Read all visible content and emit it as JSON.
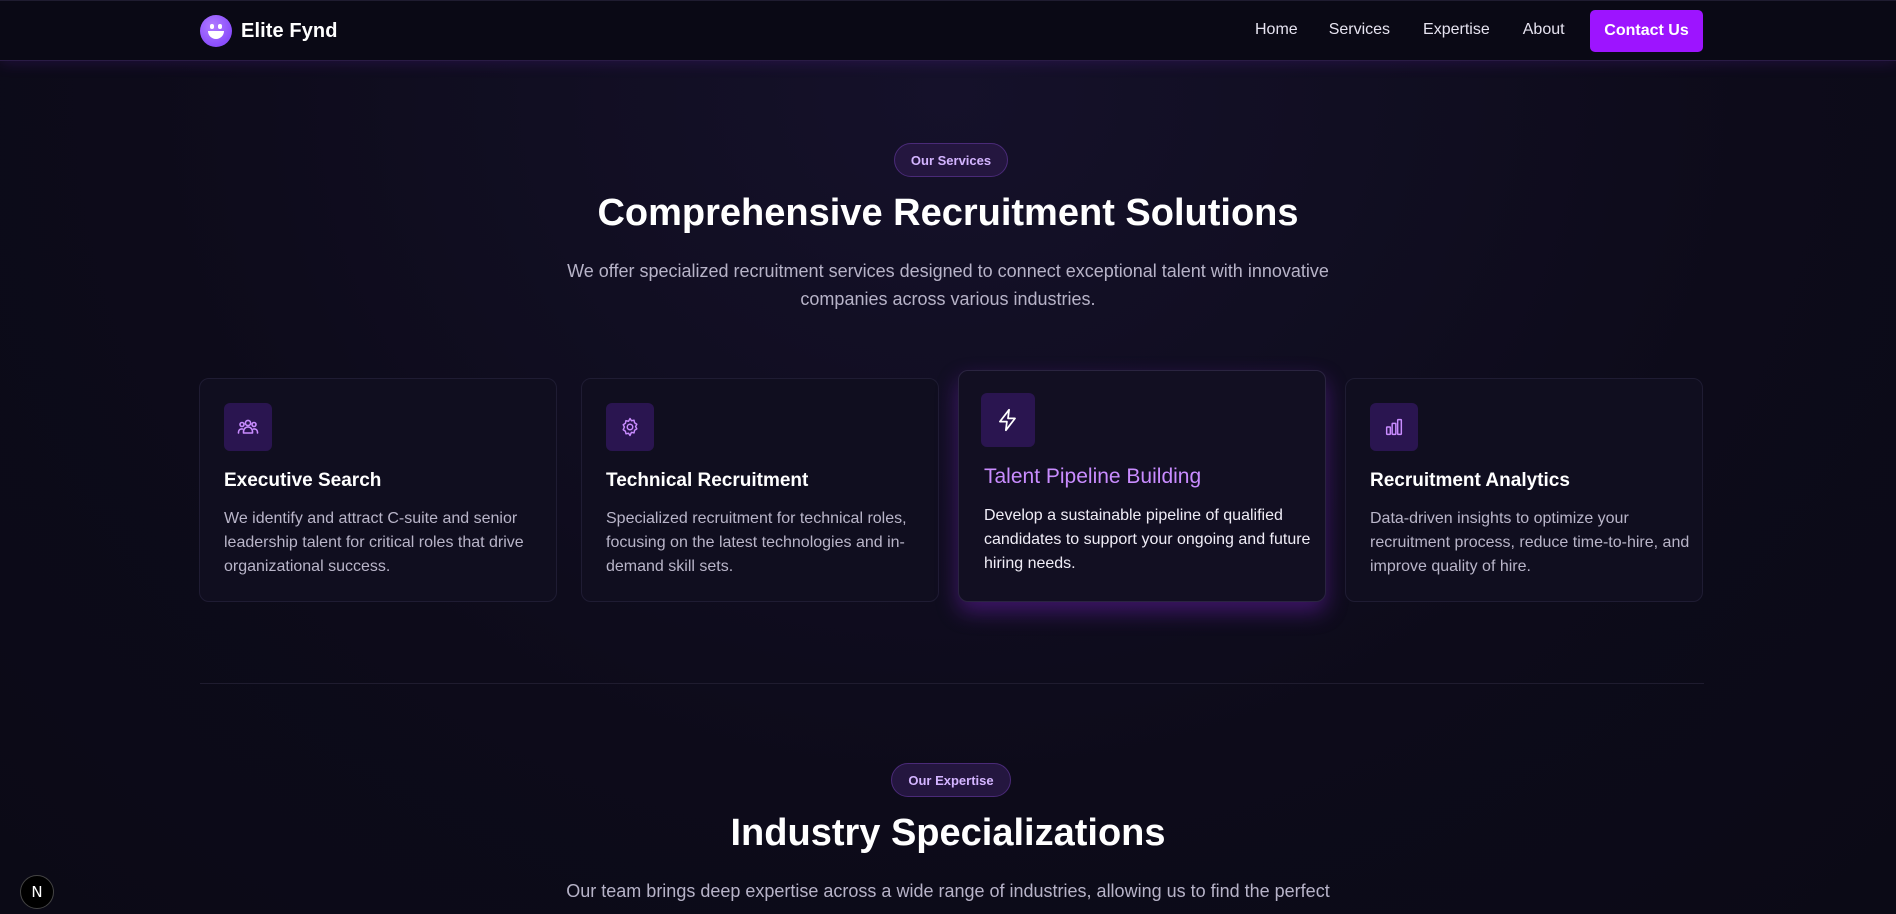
{
  "brand": {
    "name": "Elite Fynd"
  },
  "nav": {
    "links": [
      "Home",
      "Services",
      "Expertise",
      "About"
    ],
    "cta": "Contact Us"
  },
  "services": {
    "badge": "Our Services",
    "title": "Comprehensive Recruitment Solutions",
    "subtitle_line1": "We offer specialized recruitment services designed to connect exceptional talent with innovative",
    "subtitle_line2": "companies across various industries.",
    "cards": [
      {
        "icon": "users-group-icon",
        "title": "Executive Search",
        "description": "We identify and attract C-suite and senior leadership talent for critical roles that drive organizational success."
      },
      {
        "icon": "gear-icon",
        "title": "Technical Recruitment",
        "description": "Specialized recruitment for technical roles, focusing on the latest technologies and in-demand skill sets."
      },
      {
        "icon": "lightning-icon",
        "title": "Talent Pipeline Building",
        "description": "Develop a sustainable pipeline of qualified candidates to support your ongoing and future hiring needs."
      },
      {
        "icon": "bar-chart-icon",
        "title": "Recruitment Analytics",
        "description": "Data-driven insights to optimize your recruitment process, reduce time-to-hire, and improve quality of hire."
      }
    ]
  },
  "expertise": {
    "badge": "Our Expertise",
    "title": "Industry Specializations",
    "subtitle_line1": "Our team brings deep expertise across a wide range of industries, allowing us to find the perfect"
  },
  "dev_badge": {
    "letter": "N"
  },
  "colors": {
    "accent": "#9d14ff",
    "background": "#0d0b1a",
    "highlight_title": "#c98cff"
  }
}
